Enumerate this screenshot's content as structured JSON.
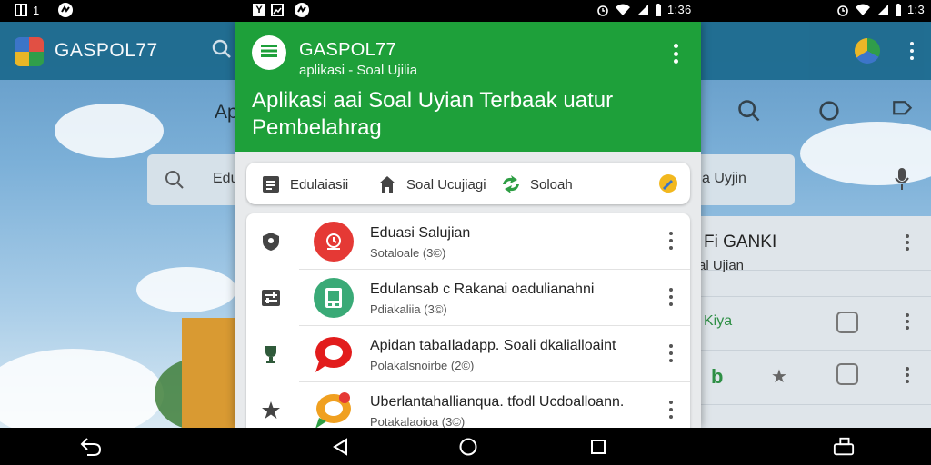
{
  "status_bar": {
    "left_time": "1",
    "middle_time": "1:36",
    "right_time": "1:3",
    "left_letter": "Y"
  },
  "background_app": {
    "title": "GASPOL77",
    "heading_fragment": "Ap",
    "search_fragment": "Edu",
    "search_right_text": "a Uyjin",
    "list_title": "Fi GANKI",
    "list_sub": "al Ujian",
    "row_label": "Kiya"
  },
  "app": {
    "title": "GASPOL77",
    "subtitle": "aplikasi - Soal Ujilia",
    "headline": "Aplikasi aai Soal Uyian Terbaak uatur Pembelahrag",
    "accent_color": "#1ea03a"
  },
  "chips": [
    {
      "label": "Edulaiasii",
      "icon": "document-icon"
    },
    {
      "label": "Soal Ucujiagi",
      "icon": "home-icon"
    },
    {
      "label": "Soloah",
      "icon": "recycle-icon"
    }
  ],
  "list_items": [
    {
      "title": "Eduasi Salujian",
      "subtitle": "Sotaloale (3©)",
      "lead_icon": "shield-icon",
      "avatar_icon": "quiz-icon",
      "avatar_color": "#e53935"
    },
    {
      "title": "Edulansab c Rakanai oadulianahni",
      "subtitle": "Pdiakaliia (3©)",
      "lead_icon": "sliders-icon",
      "avatar_icon": "book-icon",
      "avatar_color": "#3aaa77"
    },
    {
      "title": "Apidan tabaIladapp. Soali dkalialloaint",
      "subtitle": "Polakalsnoirbe (2©)",
      "lead_icon": "trophy-icon",
      "avatar_icon": "chat-icon",
      "avatar_color": "#e21c1c"
    },
    {
      "title": "Uberlantahallianqua. tfodl Ucdoalloann.",
      "subtitle": "Potakalaoioa (3©)",
      "lead_icon": "star-icon",
      "avatar_icon": "chat-icon",
      "avatar_color": "#f0a020"
    }
  ]
}
